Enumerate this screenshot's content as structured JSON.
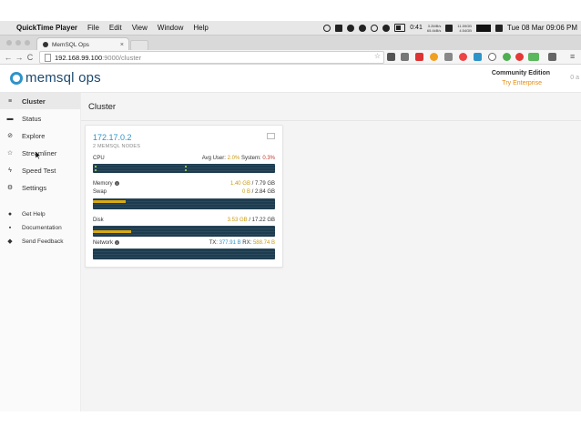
{
  "menubar": {
    "app_name": "QuickTime Player",
    "items": [
      "File",
      "Edit",
      "View",
      "Window",
      "Help"
    ],
    "battery_label": "0:41",
    "net_up": "3.2MB/s",
    "net_down": "65.4kB/s",
    "net2_up": "11.59GB",
    "net2_down": "4.54GB",
    "clock": "Tue 08 Mar  09:06 PM"
  },
  "browser": {
    "tab_title": "MemSQL Ops",
    "tab_close": "×",
    "url_host": "192.168.99.100",
    "url_path": ":9000/cluster",
    "back": "←",
    "forward": "→",
    "reload": "C",
    "star": "☆"
  },
  "header": {
    "logo_text": "memsql ops",
    "edition": "Community Edition",
    "try_link": "Try Enterprise",
    "extra": "0 a"
  },
  "sidebar": {
    "items": [
      {
        "label": "Cluster",
        "icon": "≡"
      },
      {
        "label": "Status",
        "icon": "▬"
      },
      {
        "label": "Explore",
        "icon": "⊘"
      },
      {
        "label": "Streamliner",
        "icon": "☆"
      },
      {
        "label": "Speed Test",
        "icon": "ϟ"
      },
      {
        "label": "Settings",
        "icon": "⚙"
      }
    ],
    "bottom_items": [
      {
        "label": "Get Help",
        "icon": "●"
      },
      {
        "label": "Documentation",
        "icon": "▪"
      },
      {
        "label": "Send Feedback",
        "icon": "◆"
      }
    ]
  },
  "main": {
    "title": "Cluster",
    "card": {
      "host": "172.17.0.2",
      "nodes": "2 MEMSQL NODES",
      "cpu_label": "CPU",
      "cpu_user_label": "Avg User:",
      "cpu_user": "2.0%",
      "cpu_system_label": "System:",
      "cpu_system": "0.3%",
      "memory_label": "Memory",
      "memory_used": "1.40 GB",
      "memory_total": "/ 7.79 GB",
      "memory_fraction": 0.18,
      "swap_label": "Swap",
      "swap_used": "0 B",
      "swap_total": "/ 2.84 GB",
      "swap_fraction": 0.19,
      "disk_label": "Disk",
      "disk_used": "3.53 GB",
      "disk_total": "/ 17.22 GB",
      "disk_fraction": 0.21,
      "network_label": "Network",
      "tx_label": "TX:",
      "tx": "377.91 B",
      "rx_label": "RX:",
      "rx": "588.74 B"
    }
  },
  "colors": {
    "accent": "#2f93c9",
    "warning": "#e38d13",
    "bar_bg": "#1d3c50",
    "bar_fill": "#d9ab12"
  }
}
